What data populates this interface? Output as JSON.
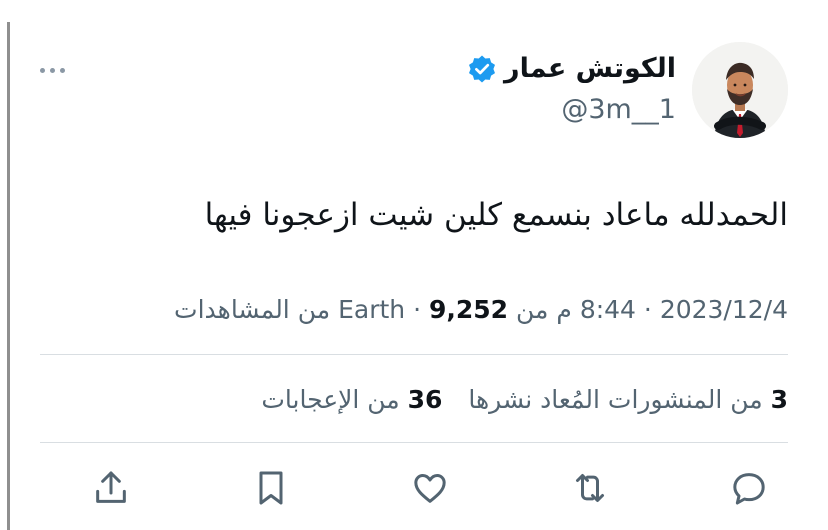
{
  "tweet": {
    "author": {
      "display_name": "الكوتش عمار",
      "handle": "@3m__1",
      "verified": true,
      "verified_badge_icon": "verified-badge-icon",
      "avatar_icon": "avatar"
    },
    "text": "الحمدلله ماعاد بنسمع كلين شيت ازعجونا فيها",
    "meta": {
      "date": "2023/12/4",
      "separator": "·",
      "time": "8:44 م من Earth",
      "views_count": "9,252",
      "views_label": "من المشاهدات"
    },
    "stats": {
      "reposts_count": "3",
      "reposts_label": "من المنشورات المُعاد نشرها",
      "likes_count": "36",
      "likes_label": "من الإعجابات"
    },
    "actions": [
      "reply-icon",
      "repost-icon",
      "like-icon",
      "bookmark-icon",
      "share-icon"
    ],
    "more_icon": "more-options-icon"
  },
  "colors": {
    "text": "#0f1419",
    "muted": "#536471",
    "verified": "#1d9bf0",
    "divider": "#d9dee2",
    "icon": "#536471"
  }
}
